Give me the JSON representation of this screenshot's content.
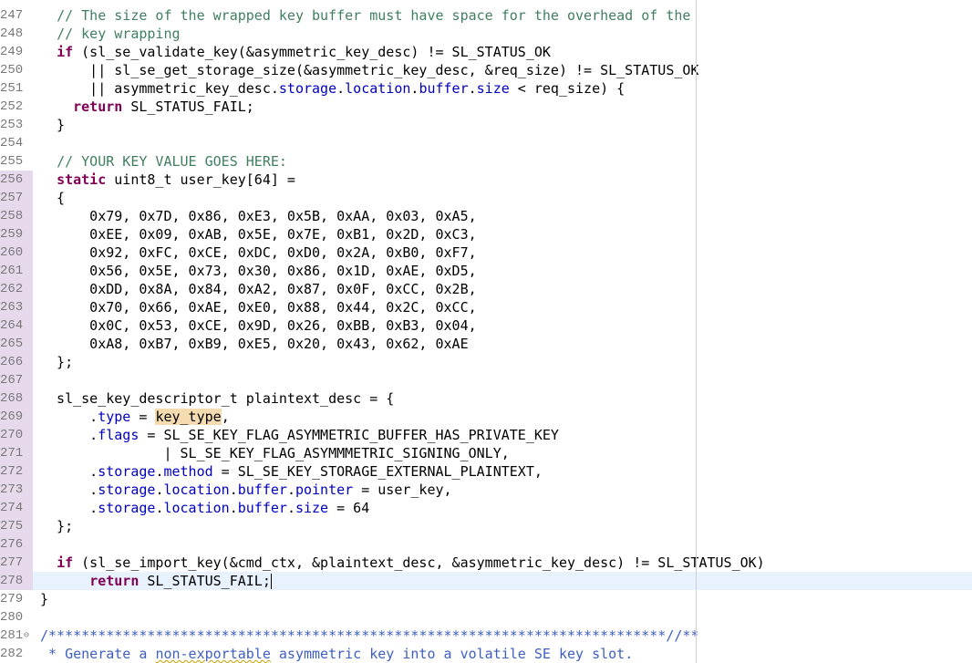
{
  "editor": {
    "lines": [
      {
        "n": "247",
        "segs": [
          {
            "t": "  "
          },
          {
            "t": "// The size of the wrapped key buffer must have space for the overhead of the",
            "c": "cm"
          }
        ]
      },
      {
        "n": "248",
        "segs": [
          {
            "t": "  "
          },
          {
            "t": "// key wrapping",
            "c": "cm"
          }
        ]
      },
      {
        "n": "249",
        "segs": [
          {
            "t": "  "
          },
          {
            "t": "if",
            "c": "kw"
          },
          {
            "t": " (sl_se_validate_key(&asymmetric_key_desc) != SL_STATUS_OK"
          }
        ]
      },
      {
        "n": "250",
        "segs": [
          {
            "t": "      || sl_se_get_storage_size(&asymmetric_key_desc, &req_size) != SL_STATUS_OK"
          }
        ]
      },
      {
        "n": "251",
        "segs": [
          {
            "t": "      || asymmetric_key_desc."
          },
          {
            "t": "storage",
            "c": "fld"
          },
          {
            "t": "."
          },
          {
            "t": "location",
            "c": "fld"
          },
          {
            "t": "."
          },
          {
            "t": "buffer",
            "c": "fld"
          },
          {
            "t": "."
          },
          {
            "t": "size",
            "c": "fld"
          },
          {
            "t": " < req_size) {"
          }
        ]
      },
      {
        "n": "252",
        "segs": [
          {
            "t": "    "
          },
          {
            "t": "return",
            "c": "kw"
          },
          {
            "t": " SL_STATUS_FAIL;"
          }
        ]
      },
      {
        "n": "253",
        "segs": [
          {
            "t": "  }"
          }
        ]
      },
      {
        "n": "254",
        "segs": []
      },
      {
        "n": "255",
        "segs": [
          {
            "t": "  "
          },
          {
            "t": "// YOUR KEY VALUE GOES HERE:",
            "c": "cm"
          }
        ]
      },
      {
        "n": "256",
        "segs": [
          {
            "t": "  "
          },
          {
            "t": "static",
            "c": "kw"
          },
          {
            "t": " uint8_t user_key[64] ="
          }
        ],
        "changed": true
      },
      {
        "n": "257",
        "segs": [
          {
            "t": "  {"
          }
        ],
        "changed": true
      },
      {
        "n": "258",
        "segs": [
          {
            "t": "      0x79, 0x7D, 0x86, 0xE3, 0x5B, 0xAA, 0x03, 0xA5,"
          }
        ],
        "changed": true
      },
      {
        "n": "259",
        "segs": [
          {
            "t": "      0xEE, 0x09, 0xAB, 0x5E, 0x7E, 0xB1, 0x2D, 0xC3,"
          }
        ],
        "changed": true
      },
      {
        "n": "260",
        "segs": [
          {
            "t": "      0x92, 0xFC, 0xCE, 0xDC, 0xD0, 0x2A, 0xB0, 0xF7,"
          }
        ],
        "changed": true
      },
      {
        "n": "261",
        "segs": [
          {
            "t": "      0x56, 0x5E, 0x73, 0x30, 0x86, 0x1D, 0xAE, 0xD5,"
          }
        ],
        "changed": true
      },
      {
        "n": "262",
        "segs": [
          {
            "t": "      0xDD, 0x8A, 0x84, 0xA2, 0x87, 0x0F, 0xCC, 0x2B,"
          }
        ],
        "changed": true
      },
      {
        "n": "263",
        "segs": [
          {
            "t": "      0x70, 0x66, 0xAE, 0xE0, 0x88, 0x44, 0x2C, 0xCC,"
          }
        ],
        "changed": true
      },
      {
        "n": "264",
        "segs": [
          {
            "t": "      0x0C, 0x53, 0xCE, 0x9D, 0x26, 0xBB, 0xB3, 0x04,"
          }
        ],
        "changed": true
      },
      {
        "n": "265",
        "segs": [
          {
            "t": "      0xA8, 0xB7, 0xB9, 0xE5, 0x20, 0x43, 0x62, 0xAE"
          }
        ],
        "changed": true
      },
      {
        "n": "266",
        "segs": [
          {
            "t": "  };"
          }
        ],
        "changed": true
      },
      {
        "n": "267",
        "segs": [],
        "changed": true
      },
      {
        "n": "268",
        "segs": [
          {
            "t": "  sl_se_key_descriptor_t plaintext_desc = {"
          }
        ],
        "changed": true
      },
      {
        "n": "269",
        "segs": [
          {
            "t": "      ."
          },
          {
            "t": "type",
            "c": "fld"
          },
          {
            "t": " = "
          },
          {
            "t": "key_type",
            "c": "mark"
          },
          {
            "t": ","
          }
        ],
        "changed": true
      },
      {
        "n": "270",
        "segs": [
          {
            "t": "      ."
          },
          {
            "t": "flags",
            "c": "fld"
          },
          {
            "t": " = SL_SE_KEY_FLAG_ASYMMETRIC_BUFFER_HAS_PRIVATE_KEY"
          }
        ],
        "changed": true
      },
      {
        "n": "271",
        "segs": [
          {
            "t": "               | SL_SE_KEY_FLAG_ASYMMMETRIC_SIGNING_ONLY,"
          }
        ],
        "changed": true
      },
      {
        "n": "272",
        "segs": [
          {
            "t": "      ."
          },
          {
            "t": "storage",
            "c": "fld"
          },
          {
            "t": "."
          },
          {
            "t": "method",
            "c": "fld"
          },
          {
            "t": " = SL_SE_KEY_STORAGE_EXTERNAL_PLAINTEXT,"
          }
        ],
        "changed": true
      },
      {
        "n": "273",
        "segs": [
          {
            "t": "      ."
          },
          {
            "t": "storage",
            "c": "fld"
          },
          {
            "t": "."
          },
          {
            "t": "location",
            "c": "fld"
          },
          {
            "t": "."
          },
          {
            "t": "buffer",
            "c": "fld"
          },
          {
            "t": "."
          },
          {
            "t": "pointer",
            "c": "fld"
          },
          {
            "t": " = user_key,"
          }
        ],
        "changed": true
      },
      {
        "n": "274",
        "segs": [
          {
            "t": "      ."
          },
          {
            "t": "storage",
            "c": "fld"
          },
          {
            "t": "."
          },
          {
            "t": "location",
            "c": "fld"
          },
          {
            "t": "."
          },
          {
            "t": "buffer",
            "c": "fld"
          },
          {
            "t": "."
          },
          {
            "t": "size",
            "c": "fld"
          },
          {
            "t": " = 64"
          }
        ],
        "changed": true
      },
      {
        "n": "275",
        "segs": [
          {
            "t": "  };"
          }
        ],
        "changed": true
      },
      {
        "n": "276",
        "segs": [],
        "changed": true
      },
      {
        "n": "277",
        "segs": [
          {
            "t": "  "
          },
          {
            "t": "if",
            "c": "kw"
          },
          {
            "t": " (sl_se_import_key(&cmd_ctx, &plaintext_desc, &asymmetric_key_desc) != SL_STATUS_OK)"
          }
        ],
        "changed": true
      },
      {
        "n": "278",
        "segs": [
          {
            "t": "      "
          },
          {
            "t": "return",
            "c": "kw"
          },
          {
            "t": " SL_STATUS_FAIL;"
          }
        ],
        "changed": true,
        "current": true,
        "caret": true
      },
      {
        "n": "279",
        "segs": [
          {
            "t": "}"
          }
        ]
      },
      {
        "n": "280",
        "segs": []
      },
      {
        "n": "281",
        "segs": [
          {
            "t": "/***************************************************************************//**",
            "c": "dc"
          }
        ],
        "fold": "⊖"
      },
      {
        "n": "282",
        "segs": [
          {
            "t": " * Generate a ",
            "c": "dc"
          },
          {
            "t": "non-exportable",
            "c": "dc squig"
          },
          {
            "t": " asymmetric key into a volatile SE key slot.",
            "c": "dc"
          }
        ]
      }
    ]
  }
}
